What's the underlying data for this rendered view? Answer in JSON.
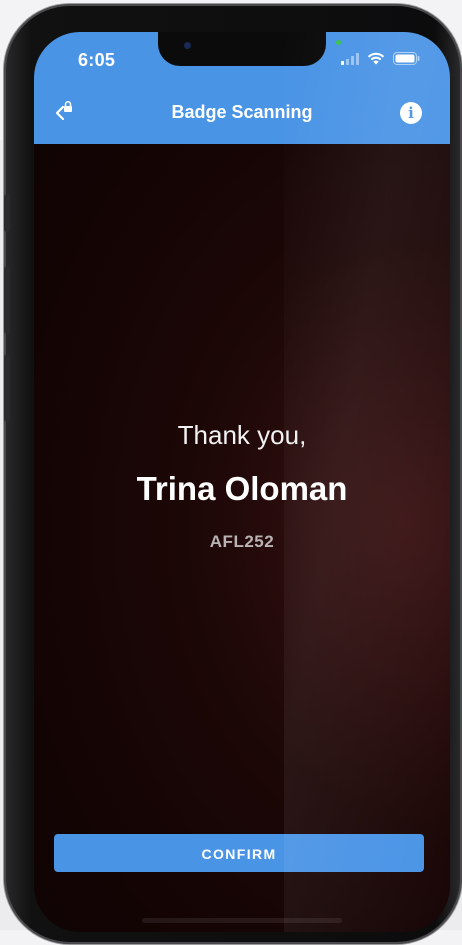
{
  "status_bar": {
    "time": "6:05"
  },
  "header": {
    "title": "Badge Scanning",
    "back_icon": "back-lock-icon",
    "info_label": "i"
  },
  "content": {
    "thanks_text": "Thank you,",
    "attendee_name": "Trina Oloman",
    "attendee_code": "AFL252"
  },
  "actions": {
    "confirm_label": "CONFIRM"
  },
  "colors": {
    "accent": "#4a94e6",
    "background": "#1d0707"
  }
}
